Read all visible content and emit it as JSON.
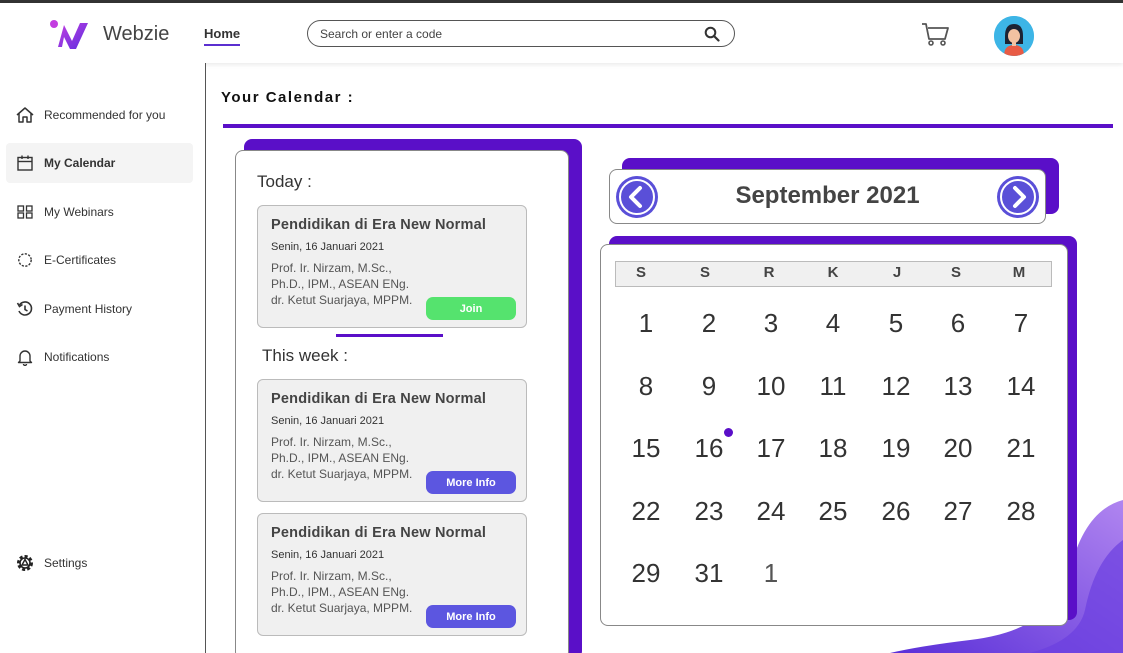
{
  "header": {
    "brand": "Webzie",
    "nav_home": "Home",
    "search_placeholder": "Search or enter a code"
  },
  "sidebar": {
    "items": [
      {
        "label": "Recommended for you",
        "icon": "home-icon"
      },
      {
        "label": "My Calendar",
        "icon": "calendar-icon",
        "active": true
      },
      {
        "label": "My Webinars",
        "icon": "grid-icon"
      },
      {
        "label": "E-Certificates",
        "icon": "certificate-icon"
      },
      {
        "label": "Payment History",
        "icon": "history-icon"
      },
      {
        "label": "Notifications",
        "icon": "bell-icon"
      }
    ],
    "settings": {
      "label": "Settings",
      "icon": "gear-icon"
    }
  },
  "main": {
    "title": "Your Calendar :",
    "today_label": "Today :",
    "week_label": "This week :",
    "today_cards": [
      {
        "title": "Pendidikan di Era New Normal",
        "date": "Senin, 16 Januari 2021",
        "speakers": [
          "Prof. Ir. Nirzam, M.Sc.,",
          "Ph.D., IPM., ASEAN ENg.",
          "dr. Ketut Suarjaya, MPPM."
        ],
        "button": "Join"
      }
    ],
    "week_cards": [
      {
        "title": "Pendidikan di Era New Normal",
        "date": "Senin, 16 Januari 2021",
        "speakers": [
          "Prof. Ir. Nirzam, M.Sc.,",
          "Ph.D., IPM., ASEAN ENg.",
          "dr. Ketut Suarjaya, MPPM."
        ],
        "button": "More Info"
      },
      {
        "title": "Pendidikan di Era New Normal",
        "date": "Senin, 16 Januari 2021",
        "speakers": [
          "Prof. Ir. Nirzam, M.Sc.,",
          "Ph.D., IPM., ASEAN ENg.",
          "dr. Ketut Suarjaya, MPPM."
        ],
        "button": "More Info"
      }
    ]
  },
  "calendar": {
    "month": "September 2021",
    "weekdays": [
      "S",
      "S",
      "R",
      "K",
      "J",
      "S",
      "M"
    ],
    "weeks": [
      [
        "1",
        "2",
        "3",
        "4",
        "5",
        "6",
        "7"
      ],
      [
        "8",
        "9",
        "10",
        "11",
        "12",
        "13",
        "14"
      ],
      [
        "15",
        "16",
        "17",
        "18",
        "19",
        "20",
        "21"
      ],
      [
        "22",
        "23",
        "24",
        "25",
        "26",
        "27",
        "28"
      ],
      [
        "29",
        "31",
        "1"
      ]
    ],
    "event_day": "16"
  },
  "colors": {
    "accent": "#5a0fc8",
    "join_button": "#55e36e",
    "info_button": "#5c56e0",
    "nav_arrow": "#5a4fd8"
  }
}
